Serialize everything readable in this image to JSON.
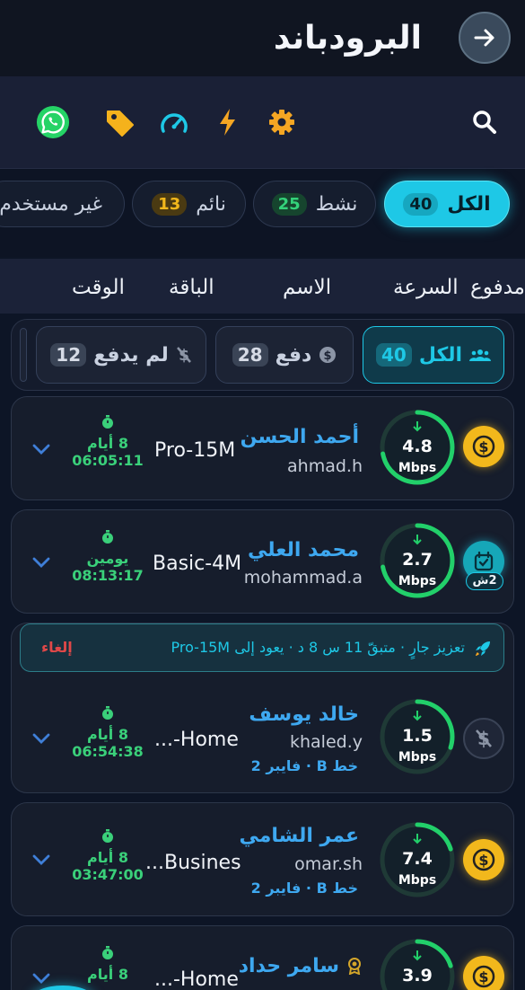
{
  "header": {
    "title": "البرودباند",
    "back_icon": "arrow-right-icon"
  },
  "toolbar": {
    "icons": [
      "search-icon",
      "gear-icon",
      "lightning-icon",
      "speedometer-icon",
      "tag-icon",
      "whatsapp-icon"
    ]
  },
  "filter_chips": [
    {
      "label": "الكل",
      "count": "40",
      "active": true
    },
    {
      "label": "نشط",
      "count": "25"
    },
    {
      "label": "نائم",
      "count": "13"
    },
    {
      "label": "غير مستخدم"
    }
  ],
  "columns": [
    "مدفوع",
    "السرعة",
    "الاسم",
    "الباقة",
    "الوقت"
  ],
  "payment_filters": [
    {
      "label": "الكل",
      "count": "40",
      "active": true
    },
    {
      "label": "دفع",
      "count": "28"
    },
    {
      "label": "لم يدفع",
      "count": "12"
    }
  ],
  "boost": {
    "text": "تعزيز جارٍ · متبقّ 11 س 8 د · يعود إلى Pro-15M",
    "cancel": "إلغاء"
  },
  "subscribers": [
    {
      "name": "أحمد الحسن",
      "username": "ahmad.h",
      "speed": "4.8",
      "unit": "Mbps",
      "fill": 0.72,
      "package": "Pro-15M",
      "days": "8 أيام",
      "time": "06:05:11",
      "status": "paid"
    },
    {
      "name": "محمد العلي",
      "username": "mohammad.a",
      "speed": "2.7",
      "unit": "Mbps",
      "fill": 0.72,
      "package": "Basic-4M",
      "days": "يومين",
      "time": "08:13:17",
      "status": "scheduled",
      "status_badge": "2ش"
    },
    {
      "name": "خالد يوسف",
      "username": "khaled.y",
      "line": "خط B · فايبر 2",
      "speed": "1.5",
      "unit": "Mbps",
      "fill": 0.3,
      "package": "Home-...",
      "days": "8 أيام",
      "time": "06:54:38",
      "status": "unpaid"
    },
    {
      "name": "عمر الشامي",
      "username": "omar.sh",
      "line": "خط B · فايبر 2",
      "speed": "7.4",
      "unit": "Mbps",
      "fill": 0.2,
      "package": "Busines...",
      "days": "8 أيام",
      "time": "03:47:00",
      "status": "paid"
    },
    {
      "name": "سامر حداد",
      "speed": "3.9",
      "unit": "Mbps",
      "fill": 0.2,
      "package": "Home-...",
      "days": "8 أيام",
      "status": "paid"
    }
  ],
  "colors": {
    "accent": "#1ec8e6",
    "green": "#22d06a",
    "gold": "#f2b81c",
    "blue": "#3ea8f0"
  }
}
